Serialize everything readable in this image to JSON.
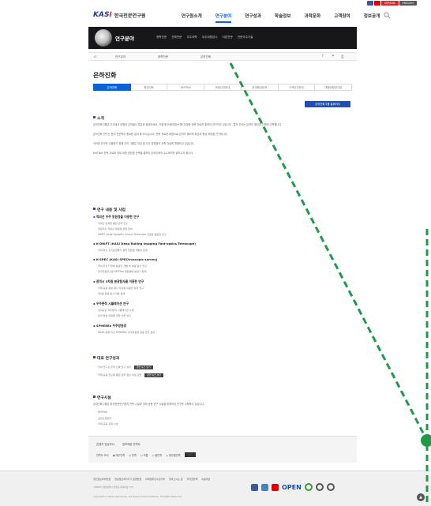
{
  "utility": {
    "colors": [
      "#3b5998",
      "#ff0000",
      "#2a6ad2",
      "#555555"
    ],
    "buttons": [
      "KOREAN",
      "ENGLISH"
    ]
  },
  "header": {
    "logo_mark": "KASI",
    "logo_name": "한국천문연구원",
    "nav": [
      "연구원소개",
      "연구분야",
      "연구성과",
      "학술정보",
      "과학문화",
      "고객참여",
      "정보공개"
    ],
    "active_nav": 1
  },
  "hero": {
    "title": "연구분야",
    "subnav": [
      "광학천문",
      "전파천문",
      "우주과학",
      "우주위험감시",
      "이론천문",
      "천문우주기술"
    ]
  },
  "breadcrumb": {
    "items": [
      "연구분야",
      "광학천문",
      "은하진화"
    ]
  },
  "page": {
    "title": "은하진화",
    "tabs": [
      "은하진화",
      "항성진화",
      "KMTNet",
      "보현산천문대",
      "외계행성탐색",
      "소백산천문대",
      "대형망원경사업"
    ],
    "active_tab": 0,
    "homepage_button": "은하진화그룹 홈페이지"
  },
  "sections": {
    "intro_title": "소개",
    "intro_text": [
      "은하진화그룹은 우주에서 대형의 은하들이 특유한 환경속에서, 어떻게 탄생하였는지를 다양한 관측 자료를 통하여 연구하고 있습니다. 특히 우리는 은하의 형성과 진화에 주목합니다.",
      "은하진화 연구는 현대 천문학의 중요한 분야 중 하나입니다. 관측 자료를 바탕으로 은하의 물리적 특성과 형성 과정을 연구합니다.",
      "이러한 연구를 수행하기 위해 우리 그룹은 지상 및 우주 망원경의 관측 자료를 활용하고 있습니다.",
      "KMTNet 관측 자료와 외부 대형 망원경 관측을 통하여 은하진화의 수수께끼를 밝히고자 합니다."
    ],
    "work_title": "연구 내용 및 사업",
    "subs": [
      {
        "title": "적외선 우주 망원경을 이용한 연구",
        "bullets": [
          "적외선 관측을 통한 은하 연구",
          "천문우주 적외선 망원경 운영 참여",
          "UKIRT Large Synoptic Survey Telescope 자료를 활용한 연구"
        ]
      },
      {
        "title": "K-DRIFT (KASI Deep Rolling Imaging Fast-optics Telescope)",
        "bullets": [
          "국내 최초 초저표면밝기 광학 망원경 개발과 운영"
        ]
      },
      {
        "title": "K-SPEC (KASI SPECtroscopic survey)",
        "bullets": [
          "국내 최초 다천체 분광기 개발 및 분광 탐사 연구",
          "한국천문연구원 KMTNet 망원경에 분광기 탑재"
        ]
      },
      {
        "title": "광역시 3차원 분광탐사를 이용한 연구",
        "bullets": [
          "국제 공동 분광 탐사 자료를 이용한 은하 연구",
          "3차원 분광 탐사 자료 분석"
        ]
      },
      {
        "title": "우주론적 시뮬레이션 연구",
        "bullets": [
          "초대규모 우주론적 시뮬레이션 수행",
          "은하 형성 과정에 대한 이론 연구"
        ]
      },
      {
        "title": "SPHEREx 우주망원경",
        "bullets": [
          "NASA 중형 미션 SPHEREx 우주망원경 공동 연구 참여"
        ]
      }
    ],
    "results_title": "대표 연구성과",
    "results": [
      "국내 연구진 은하 진화 연구 성과",
      "국제 공동 연구를 통한 은하 형성 과정 규명"
    ],
    "results_button": "관련 뉴스 보기",
    "facility_title": "연구시설",
    "facility_text": "은하진화그룹은 한국천문연구원의 관측 시설과 국제 공동 연구 시설을 활용하여 연구를 수행하고 있습니다.",
    "facility_bullets": [
      "KMTNet",
      "보현산천문대",
      "국제 공동 관측 시설"
    ]
  },
  "survey": {
    "tabs": [
      "콘텐츠 담당부서",
      "정보제공 만족도"
    ],
    "label": "만족도 조사",
    "options": [
      "매우만족",
      "만족",
      "보통",
      "불만족",
      "매우불만족"
    ],
    "submit": "평가"
  },
  "footer": {
    "links": [
      "개인정보처리방침",
      "영상정보처리기기 운영방침",
      "이메일무단수집거부",
      "찾아오시는 길",
      "저작권정책",
      "이용약관"
    ],
    "address": "(34055) 대전광역시 유성구 대덕대로 776",
    "copyright": "Copyright (c) Korea Astronomy and Space Science Institute. All Rights Reserved.",
    "open_label": "OPEN"
  }
}
